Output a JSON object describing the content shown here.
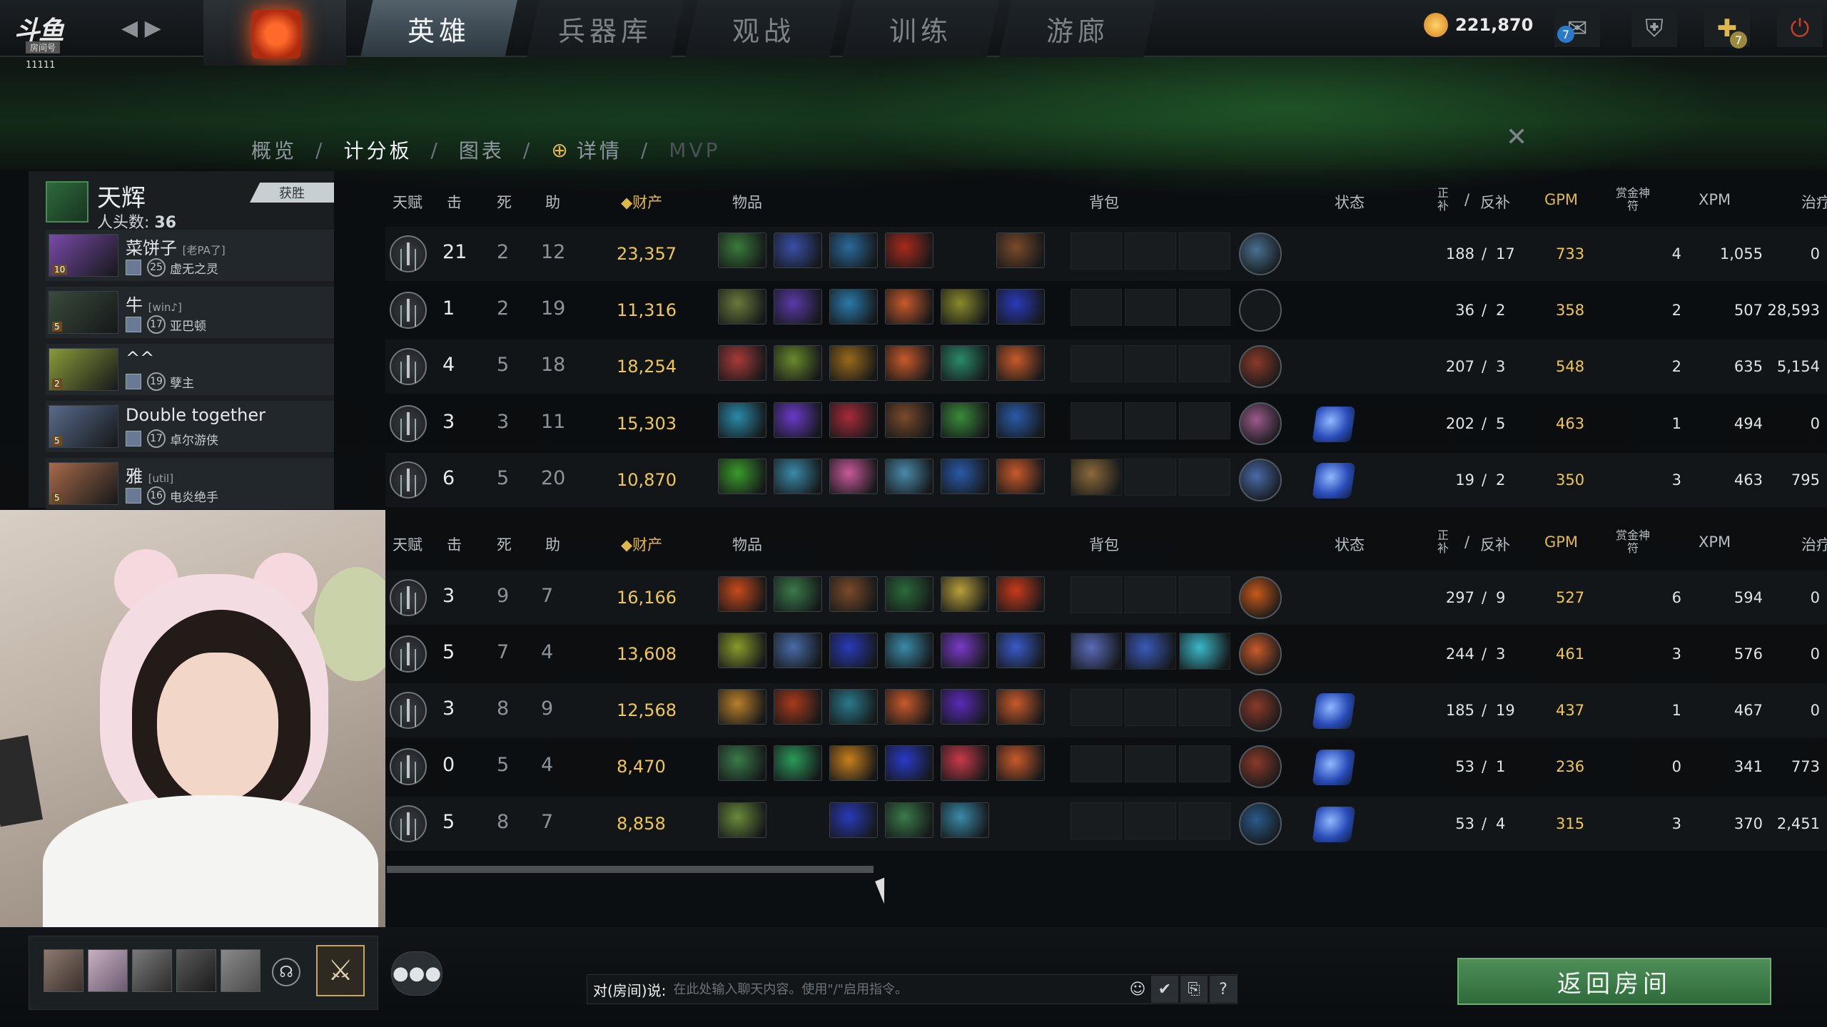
{
  "topbar": {
    "logo_text": "斗鱼",
    "room_label": "房间号",
    "room_number": "11111",
    "tabs": [
      {
        "label": "英雄",
        "active": true
      },
      {
        "label": "兵器库",
        "active": false
      },
      {
        "label": "观战",
        "active": false
      },
      {
        "label": "训练",
        "active": false
      },
      {
        "label": "游廊",
        "active": false
      }
    ],
    "gold": "221,870",
    "mail_count": "7",
    "plus_count": "7"
  },
  "subnav": {
    "items": [
      "概览",
      "计分板",
      "图表",
      "详情",
      "MVP"
    ],
    "active": "计分板"
  },
  "team": {
    "name": "天辉",
    "kills_label": "人头数:",
    "kills": "36",
    "result": "获胜",
    "players": [
      {
        "name": "菜饼子",
        "tag": "[老PA了]",
        "level": "25",
        "hero": "虚无之灵",
        "hero_level": "10"
      },
      {
        "name": "牛",
        "tag": "[win♪]",
        "level": "17",
        "hero": "亚巴顿",
        "hero_level": "5"
      },
      {
        "name": "^^",
        "tag": "",
        "level": "19",
        "hero": "孽主",
        "hero_level": "2"
      },
      {
        "name": "Double together",
        "tag": "",
        "level": "17",
        "hero": "卓尔游侠",
        "hero_level": "5"
      },
      {
        "name": "雅",
        "tag": "[util]",
        "level": "16",
        "hero": "电炎绝手",
        "hero_level": "5"
      }
    ]
  },
  "headers": {
    "talent": "天赋",
    "kills": "击",
    "deaths": "死",
    "assists": "助",
    "networth": "财产",
    "items": "物品",
    "backpack": "背包",
    "status": "状态",
    "lasthits": "正\n补",
    "sep": "/",
    "denies": "反补",
    "gpm": "GPM",
    "bounty": "赏金神\n符",
    "xpm": "XPM",
    "heal": "治疗"
  },
  "radiant_rows": [
    {
      "k": "21",
      "d": "2",
      "a": "12",
      "nw": "23,357",
      "lh": "188",
      "dn": "17",
      "gpm": "733",
      "bounty": "4",
      "xpm": "1,055",
      "heal": "0",
      "items": [
        "#3a7a3a",
        "#3a4fa8",
        "#2a6a9a",
        "#a82a1a",
        "",
        "#7a4a2a"
      ],
      "backpack": [],
      "neutral": "#4a7090",
      "status": []
    },
    {
      "k": "1",
      "d": "2",
      "a": "19",
      "nw": "11,316",
      "lh": "36",
      "dn": "2",
      "gpm": "358",
      "bounty": "2",
      "xpm": "507",
      "heal": "28,593",
      "items": [
        "#6a7a3a",
        "#5a3aa8",
        "#2a7aaa",
        "#c85a2a",
        "#8a8a2a",
        "#2a3ab8"
      ],
      "backpack": [],
      "neutral": "",
      "status": []
    },
    {
      "k": "4",
      "d": "5",
      "a": "18",
      "nw": "18,254",
      "lh": "207",
      "dn": "3",
      "gpm": "548",
      "bounty": "2",
      "xpm": "635",
      "heal": "5,154",
      "items": [
        "#a83a3a",
        "#6a8a2a",
        "#9a6a1a",
        "#c85a2a",
        "#2a8a6a",
        "#c85a2a"
      ],
      "backpack": [],
      "neutral": "#8a3a2a",
      "status": []
    },
    {
      "k": "3",
      "d": "3",
      "a": "11",
      "nw": "15,303",
      "lh": "202",
      "dn": "5",
      "gpm": "463",
      "bounty": "1",
      "xpm": "494",
      "heal": "0",
      "items": [
        "#2a8aa8",
        "#6a3ac8",
        "#a82a3a",
        "#7a4a2a",
        "#3a8a3a",
        "#2a5aa8"
      ],
      "backpack": [],
      "neutral": "#9a5a8a",
      "status": [
        "aghs"
      ]
    },
    {
      "k": "6",
      "d": "5",
      "a": "20",
      "nw": "10,870",
      "lh": "19",
      "dn": "2",
      "gpm": "350",
      "bounty": "3",
      "xpm": "463",
      "heal": "795",
      "items": [
        "#3a9a2a",
        "#3a8aa8",
        "#c85a9a",
        "#4a8aaa",
        "#2a5aa8",
        "#c85a2a"
      ],
      "backpack": [
        "#8a6a3a"
      ],
      "neutral": "#4a6aa8",
      "status": [
        "aghs"
      ]
    }
  ],
  "dire_rows": [
    {
      "k": "3",
      "d": "9",
      "a": "7",
      "nw": "16,166",
      "lh": "297",
      "dn": "9",
      "gpm": "527",
      "bounty": "6",
      "xpm": "594",
      "heal": "0",
      "items": [
        "#c84a1a",
        "#3a7a4a",
        "#7a4a2a",
        "#2a6a3a",
        "#b8a03a",
        "#c83a1a"
      ],
      "backpack": [],
      "neutral": "#c85a1a",
      "status": []
    },
    {
      "k": "5",
      "d": "7",
      "a": "4",
      "nw": "13,608",
      "lh": "244",
      "dn": "3",
      "gpm": "461",
      "bounty": "3",
      "xpm": "576",
      "heal": "0",
      "items": [
        "#8a9a2a",
        "#4a6aa8",
        "#2a3ab8",
        "#3a8aa8",
        "#7a3ac8",
        "#3a5ac8"
      ],
      "backpack": [
        "#5a6ab8",
        "#3a5ab8",
        "#3ab8c8"
      ],
      "neutral": "#c85a2a",
      "status": []
    },
    {
      "k": "3",
      "d": "8",
      "a": "9",
      "nw": "12,568",
      "lh": "185",
      "dn": "19",
      "gpm": "437",
      "bounty": "1",
      "xpm": "467",
      "heal": "0",
      "items": [
        "#b8802a",
        "#a83a1a",
        "#2a7a8a",
        "#c85a2a",
        "#5a2ab8",
        "#c85a2a"
      ],
      "backpack": [],
      "neutral": "#8a3a2a",
      "status": [
        "aghs"
      ]
    },
    {
      "k": "0",
      "d": "5",
      "a": "4",
      "nw": "8,470",
      "lh": "53",
      "dn": "1",
      "gpm": "236",
      "bounty": "0",
      "xpm": "341",
      "heal": "773",
      "items": [
        "#3a7a4a",
        "#2a9a5a",
        "#c8801a",
        "#2a3ac8",
        "#c83a4a",
        "#c85a2a"
      ],
      "backpack": [],
      "neutral": "#8a3a2a",
      "status": [
        "aghs"
      ]
    },
    {
      "k": "5",
      "d": "8",
      "a": "7",
      "nw": "8,858",
      "lh": "53",
      "dn": "4",
      "gpm": "315",
      "bounty": "3",
      "xpm": "370",
      "heal": "2,451",
      "items": [
        "#6a8a3a",
        "",
        "#2a3ab8",
        "#3a7a4a",
        "#3a8aa8",
        ""
      ],
      "backpack": [],
      "neutral": "#2a5a8a",
      "status": [
        "aghs"
      ]
    }
  ],
  "chat": {
    "label": "对(房间)说:",
    "placeholder": "在此处输入聊天内容。使用\"/\"启用指令。"
  },
  "return_button": "返回房间",
  "colors": {
    "gold": "#f0c850",
    "accent_green": "#4e8f58"
  }
}
